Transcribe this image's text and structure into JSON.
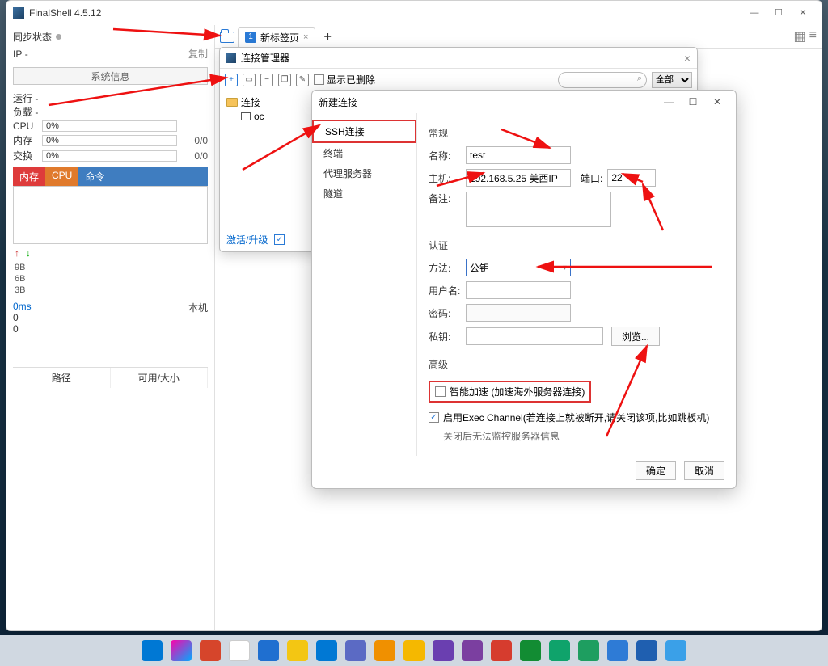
{
  "window": {
    "title": "FinalShell 4.5.12"
  },
  "sidebar": {
    "sync": "同步状态",
    "ip_label": "IP",
    "ip_value": "-",
    "copy": "复制",
    "sysinfo": "系统信息",
    "run": "运行 -",
    "load": "负载 -",
    "cpu_label": "CPU",
    "cpu_val": "0%",
    "mem_label": "内存",
    "mem_val": "0%",
    "mem_ratio": "0/0",
    "swap_label": "交换",
    "swap_val": "0%",
    "swap_ratio": "0/0",
    "tab_mem": "内存",
    "tab_cpu": "CPU",
    "tab_cmd": "命令",
    "y3": "9B",
    "y2": "6B",
    "y1": "3B",
    "lat": "0ms",
    "z1": "0",
    "z2": "0",
    "local": "本机",
    "path": "路径",
    "size": "可用/大小"
  },
  "tabs": {
    "num": "1",
    "label": "新标签页"
  },
  "conn_mgr": {
    "title": "连接管理器",
    "show_deleted": "显示已删除",
    "filter": "全部",
    "tree_root": "连接",
    "tree_item": "oc",
    "activate": "激活/升级"
  },
  "new_conn": {
    "title": "新建连接",
    "left": {
      "ssh": "SSH连接",
      "term": "终端",
      "proxy": "代理服务器",
      "tunnel": "隧道"
    },
    "grp_general": "常规",
    "name_l": "名称:",
    "name_v": "test",
    "host_l": "主机:",
    "host_v": "192.168.5.25 美西IP",
    "port_l": "端口:",
    "port_v": "22",
    "remark_l": "备注:",
    "grp_auth": "认证",
    "method_l": "方法:",
    "method_v": "公钥",
    "user_l": "用户名:",
    "pwd_l": "密码:",
    "key_l": "私钥:",
    "browse": "浏览...",
    "grp_adv": "高级",
    "smart": "智能加速 (加速海外服务器连接)",
    "exec": "启用Exec Channel(若连接上就被断开,请关闭该项,比如跳板机)",
    "exec_note": "关闭后无法监控服务器信息",
    "ok": "确定",
    "cancel": "取消"
  },
  "taskbar_colors": [
    "#0078d4",
    "#c43ac4",
    "#d6452b",
    "#ff6a00",
    "#1f6fd0",
    "#0a7c3f",
    "#f3c613",
    "#0078d4",
    "#169bd7",
    "#f5b800",
    "#7b3fa0",
    "#33a852",
    "#d63c2e",
    "#128c33",
    "#0fa36b",
    "#1e9e60",
    "#2e7bd6",
    "#1f5fb0",
    "#3aa0e8"
  ]
}
